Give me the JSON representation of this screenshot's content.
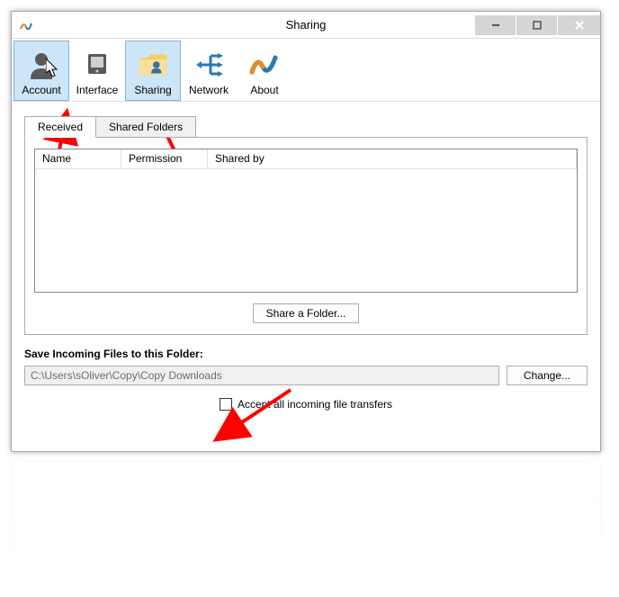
{
  "window": {
    "title": "Sharing"
  },
  "toolbar": {
    "account": "Account",
    "interface": "Interface",
    "sharing": "Sharing",
    "network": "Network",
    "about": "About"
  },
  "tabs": {
    "received": "Received",
    "shared_folders": "Shared Folders"
  },
  "columns": {
    "name": "Name",
    "permission": "Permission",
    "shared_by": "Shared by"
  },
  "buttons": {
    "share_folder": "Share a Folder...",
    "change": "Change..."
  },
  "labels": {
    "save_incoming": "Save Incoming Files to this Folder:",
    "accept_all": "Accept all incoming file transfers"
  },
  "path": "C:\\Users\\sOliver\\Copy\\Copy Downloads"
}
